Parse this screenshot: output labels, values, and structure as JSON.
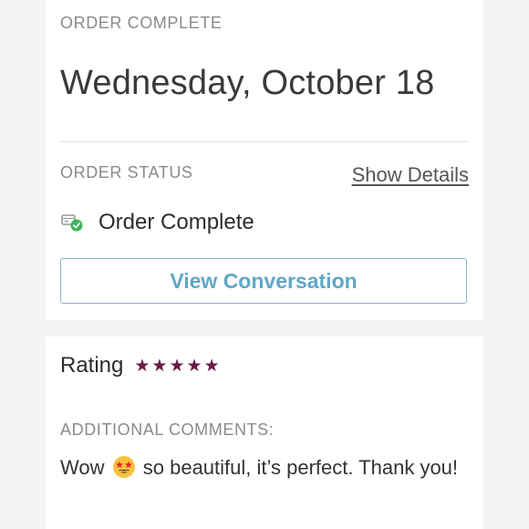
{
  "header": {
    "section_label": "ORDER COMPLETE",
    "date_title": "Wednesday, October 18"
  },
  "status": {
    "section_label": "ORDER STATUS",
    "show_details_label": "Show Details",
    "status_text": "Order Complete",
    "status_icon": "package-check-icon",
    "view_button_label": "View Conversation"
  },
  "rating": {
    "label": "Rating",
    "stars": 5,
    "star_color": "#6b1a46"
  },
  "comments": {
    "section_label": "ADDITIONAL COMMENTS:",
    "text_before_emoji": "Wow",
    "emoji": "star-struck-emoji",
    "text_after_emoji": "so beautiful, it’s perfect. Thank you!"
  },
  "colors": {
    "accent": "#5fa7c6",
    "success": "#3cb55a"
  }
}
